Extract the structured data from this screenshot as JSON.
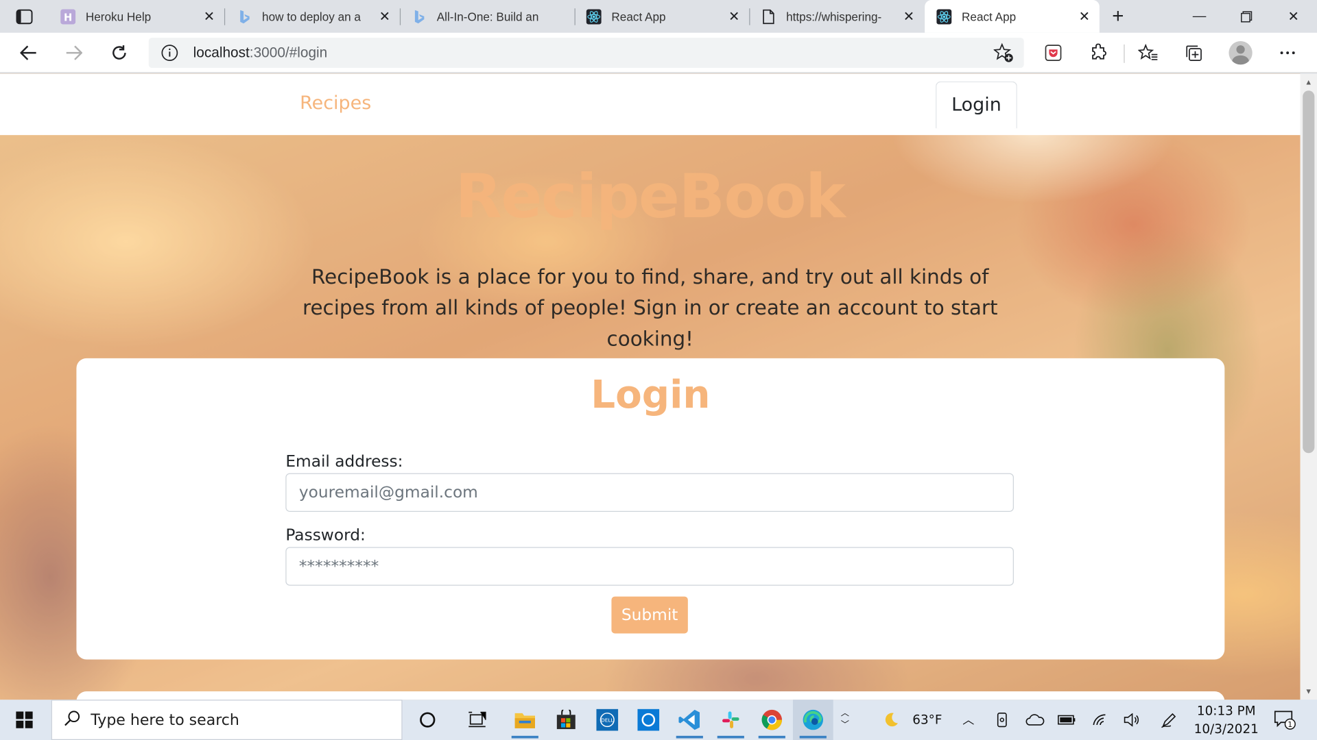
{
  "browser": {
    "tabs": [
      {
        "title": "Heroku Help",
        "icon": "heroku-icon"
      },
      {
        "title": "how to deploy an a",
        "icon": "bing-icon"
      },
      {
        "title": "All-In-One: Build an",
        "icon": "bing-icon"
      },
      {
        "title": "React App",
        "icon": "react-icon"
      },
      {
        "title": "https://whispering-",
        "icon": "page-icon"
      },
      {
        "title": "React App",
        "icon": "react-icon",
        "active": true
      }
    ],
    "url_host": "localhost",
    "url_rest": ":3000/#login"
  },
  "nav": {
    "brand_link": "Recipes",
    "login_tab": "Login"
  },
  "hero": {
    "title": "RecipeBook",
    "description": "RecipeBook is a place for you to find, share, and try out all kinds of recipes from all kinds of people! Sign in or create an account to start cooking!"
  },
  "login_form": {
    "title": "Login",
    "email_label": "Email address:",
    "email_placeholder": "youremail@gmail.com",
    "password_label": "Password:",
    "password_placeholder": "**********",
    "submit_label": "Submit"
  },
  "taskbar": {
    "search_placeholder": "Type here to search",
    "weather": "63°F",
    "time": "10:13 PM",
    "date": "10/3/2021",
    "notification_count": "1"
  },
  "colors": {
    "accent": "#f6b57c",
    "text": "#212529"
  }
}
